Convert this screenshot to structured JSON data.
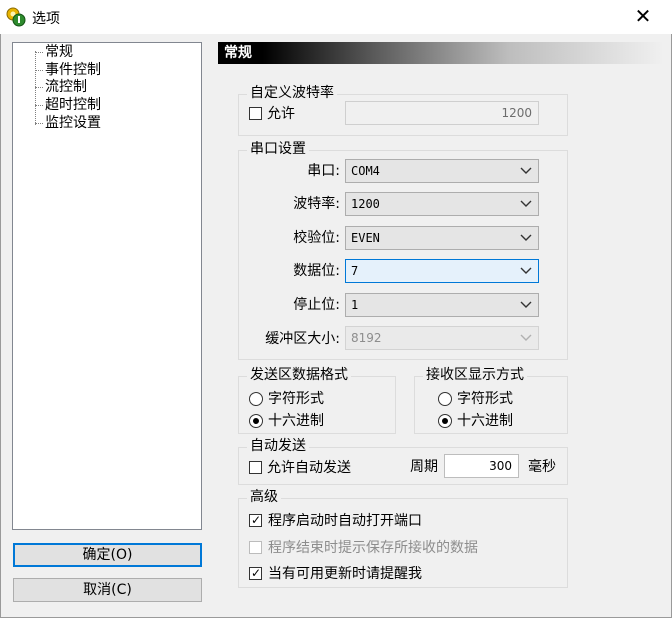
{
  "window": {
    "title": "选项",
    "close_glyph": "✕"
  },
  "tree": {
    "items": [
      {
        "label": "常规"
      },
      {
        "label": "事件控制"
      },
      {
        "label": "流控制"
      },
      {
        "label": "超时控制"
      },
      {
        "label": "监控设置"
      }
    ]
  },
  "buttons": {
    "ok": "确定(O)",
    "cancel": "取消(C)"
  },
  "header": {
    "title": "常规"
  },
  "custom_baud": {
    "title": "自定义波特率",
    "allow_label": "允许",
    "allow_checked": false,
    "value": "1200"
  },
  "serial": {
    "title": "串口设置",
    "port": {
      "label": "串口:",
      "value": "COM4"
    },
    "baud": {
      "label": "波特率:",
      "value": "1200"
    },
    "parity": {
      "label": "校验位:",
      "value": "EVEN"
    },
    "databits": {
      "label": "数据位:",
      "value": "7"
    },
    "stopbits": {
      "label": "停止位:",
      "value": "1"
    },
    "buffer": {
      "label": "缓冲区大小:",
      "value": "8192"
    }
  },
  "send_format": {
    "title": "发送区数据格式",
    "options": [
      "字符形式",
      "十六进制"
    ],
    "selected": "十六进制"
  },
  "recv_format": {
    "title": "接收区显示方式",
    "options": [
      "字符形式",
      "十六进制"
    ],
    "selected": "十六进制"
  },
  "auto_send": {
    "title": "自动发送",
    "allow_label": "允许自动发送",
    "allow_checked": false,
    "period_label": "周期",
    "period_value": "300",
    "unit": "毫秒"
  },
  "advanced": {
    "title": "高级",
    "options": [
      {
        "label": "程序启动时自动打开端口",
        "checked": true,
        "enabled": true
      },
      {
        "label": "程序结束时提示保存所接收的数据",
        "checked": false,
        "enabled": false
      },
      {
        "label": "当有可用更新时请提醒我",
        "checked": true,
        "enabled": true
      }
    ]
  },
  "colors": {
    "focus": "#0078d7",
    "header_bg": "#000000"
  },
  "icons": {
    "app": "app-options-icon",
    "close": "close-icon",
    "dropdown": "chevron-down-icon",
    "check": "check-icon"
  }
}
